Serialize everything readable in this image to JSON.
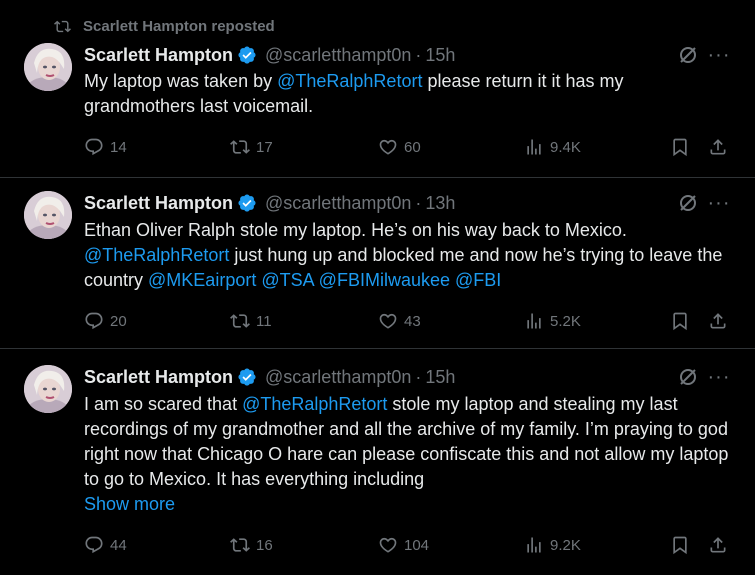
{
  "repost_banner": "Scarlett Hampton reposted",
  "tweets": [
    {
      "name": "Scarlett Hampton",
      "handle": "@scarletthampt0n",
      "dot": "·",
      "time": "15h",
      "text": {
        "p1": "My laptop was taken by ",
        "m1": "@TheRalphRetort",
        "p2": " please return it it has my grandmothers last voicemail."
      },
      "replies": "14",
      "reposts": "17",
      "likes": "60",
      "views": "9.4K"
    },
    {
      "name": "Scarlett Hampton",
      "handle": "@scarletthampt0n",
      "dot": "·",
      "time": "13h",
      "text": {
        "p1": "Ethan Oliver Ralph stole my laptop. He’s on his way back to Mexico. ",
        "m1": "@TheRalphRetort",
        "p2": " just hung up and blocked me and now he’s trying to leave the country ",
        "m2": "@MKEairport",
        "m3": "@TSA",
        "m4": "@FBIMilwaukee",
        "m5": "@FBI"
      },
      "replies": "20",
      "reposts": "11",
      "likes": "43",
      "views": "5.2K"
    },
    {
      "name": "Scarlett Hampton",
      "handle": "@scarletthampt0n",
      "dot": "·",
      "time": "15h",
      "text": {
        "p1": "I am so scared that ",
        "m1": "@TheRalphRetort",
        "p2": " stole my laptop and stealing my last recordings of my grandmother and all the archive of my family. I’m praying to god right now that Chicago O hare can please confiscate this and not allow my laptop to go to Mexico. It has everything including",
        "show_more": "Show more"
      },
      "replies": "44",
      "reposts": "16",
      "likes": "104",
      "views": "9.2K"
    }
  ],
  "colors": {
    "background": "#000000",
    "text": "#e7e9ea",
    "muted": "#71767b",
    "accent": "#1d9bf0",
    "divider": "#2f3336"
  },
  "icons": [
    "repost-icon",
    "verified-icon",
    "grok-icon",
    "more-icon",
    "reply-icon",
    "like-icon",
    "views-icon",
    "bookmark-icon",
    "share-icon"
  ]
}
